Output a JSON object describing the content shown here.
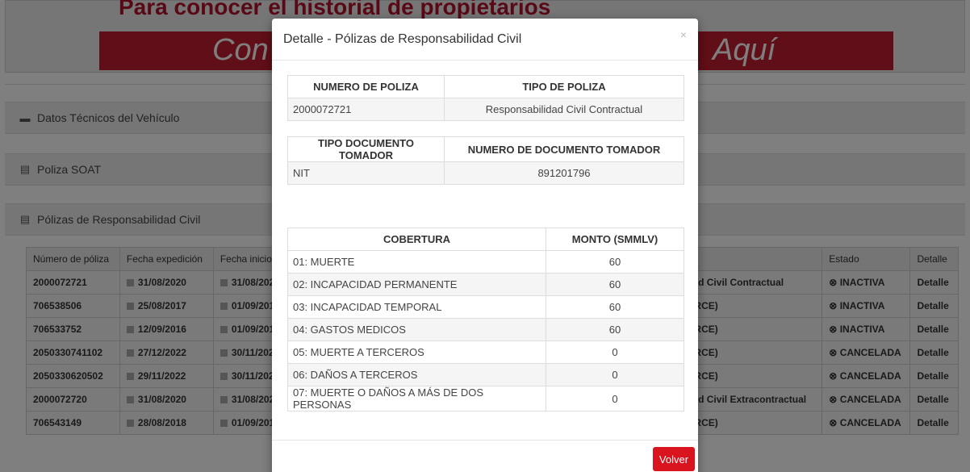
{
  "banner": {
    "top_text": "Para conocer el historial de propietarios",
    "italic_left": "Con",
    "italic_right": "Aquí"
  },
  "sections": {
    "datos_tecnicos": "Datos Técnicos del Vehículo",
    "poliza_soat": "Poliza SOAT",
    "polizas_rc": "Pólizas de Responsabilidad Civil"
  },
  "bg_table": {
    "headers": [
      "Número de póliza",
      "Fecha expedición",
      "Fecha inicio",
      "za",
      "Estado",
      "Detalle"
    ],
    "rows": [
      {
        "numero": "2000072721",
        "expedicion": "31/08/2020",
        "inicio": "31/08/202",
        "tipo": "idad Civil Contractual",
        "estado": "INACTIVA",
        "detalle": "Detalle"
      },
      {
        "numero": "706538506",
        "expedicion": "25/08/2017",
        "inicio": "01/09/201",
        "tipo": "C-RCE)",
        "estado": "INACTIVA",
        "detalle": "Detalle"
      },
      {
        "numero": "706533752",
        "expedicion": "12/09/2016",
        "inicio": "01/09/201",
        "tipo": "C-RCE)",
        "estado": "INACTIVA",
        "detalle": "Detalle"
      },
      {
        "numero": "2050330741102",
        "expedicion": "27/12/2022",
        "inicio": "30/11/202",
        "tipo": "C-RCE)",
        "estado": "CANCELADA",
        "detalle": "Detalle"
      },
      {
        "numero": "2050330620502",
        "expedicion": "29/11/2022",
        "inicio": "30/11/202",
        "tipo": "C-RCE)",
        "estado": "CANCELADA",
        "detalle": "Detalle"
      },
      {
        "numero": "2000072720",
        "expedicion": "31/08/2020",
        "inicio": "31/08/202",
        "tipo": "idad Civil Extracontractual",
        "estado": "CANCELADA",
        "detalle": "Detalle"
      },
      {
        "numero": "706543149",
        "expedicion": "28/08/2018",
        "inicio": "01/09/201",
        "tipo": "C-RCE)",
        "estado": "CANCELADA",
        "detalle": "Detalle"
      }
    ]
  },
  "modal": {
    "title": "Detalle - Pólizas de Responsabilidad Civil",
    "close": "×",
    "poliza": {
      "h_numero": "NUMERO DE POLIZA",
      "h_tipo": "TIPO DE POLIZA",
      "numero": "2000072721",
      "tipo": "Responsabilidad Civil Contractual"
    },
    "tomador": {
      "h_tipo_doc": "TIPO DOCUMENTO TOMADOR",
      "h_numero_doc": "NUMERO DE DOCUMENTO TOMADOR",
      "tipo_doc": "NIT",
      "numero_doc": "891201796"
    },
    "coberturas": {
      "h_cobertura": "COBERTURA",
      "h_monto": "MONTO (SMMLV)",
      "rows": [
        {
          "cobertura": "01: MUERTE",
          "monto": "60"
        },
        {
          "cobertura": "02: INCAPACIDAD PERMANENTE",
          "monto": "60"
        },
        {
          "cobertura": "03: INCAPACIDAD TEMPORAL",
          "monto": "60"
        },
        {
          "cobertura": "04: GASTOS MEDICOS",
          "monto": "60"
        },
        {
          "cobertura": "05: MUERTE A TERCEROS",
          "monto": "0"
        },
        {
          "cobertura": "06: DAÑOS A TERCEROS",
          "monto": "0"
        },
        {
          "cobertura": "07: MUERTE O DAÑOS A MÁS DE DOS PERSONAS",
          "monto": "0"
        }
      ]
    },
    "volver": "Volver"
  }
}
